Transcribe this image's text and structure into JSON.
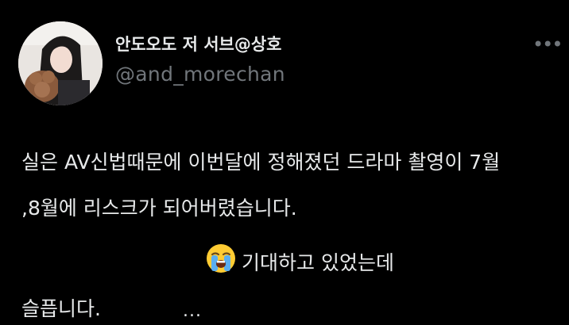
{
  "tweet": {
    "author": {
      "display_name": "안도오도 저 서브@상호",
      "handle": "@and_morechan"
    },
    "more_icon": "more-horizontal-icon",
    "text_lines": [
      "실은 AV신법때문에 이번달에 정해졌던 드라마 촬영이 7월",
      ",8월에 리스크가 되어버렸습니다.",
      "기대하고 있었는데",
      "슬픕니다."
    ],
    "emoji": "loudly-crying-face-emoji",
    "trailing_ellipsis": "..."
  },
  "colors": {
    "background": "#000000",
    "primary_text": "#e7e9ea",
    "secondary_text": "#71767b"
  }
}
